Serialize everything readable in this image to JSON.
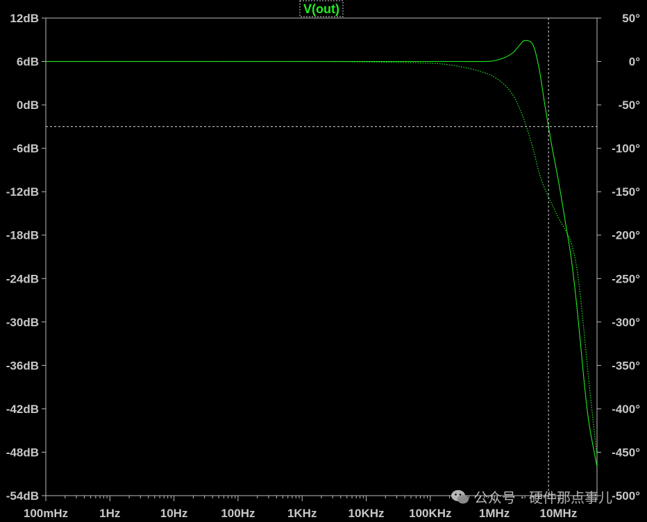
{
  "chart_data": {
    "type": "line",
    "title": "V(out)",
    "x_scale": "log",
    "xlim_hz": [
      0.1,
      40000000
    ],
    "x_tick_values_hz": [
      0.1,
      1,
      10,
      100,
      1000,
      10000,
      100000,
      1000000,
      10000000
    ],
    "x_tick_labels": [
      "100mHz",
      "1Hz",
      "10Hz",
      "100Hz",
      "1KHz",
      "10KHz",
      "100KHz",
      "1MHz",
      "10MHz"
    ],
    "y_left": {
      "unit": "dB",
      "ylim": [
        -54,
        12
      ],
      "tick_values": [
        12,
        6,
        0,
        -6,
        -12,
        -18,
        -24,
        -30,
        -36,
        -42,
        -48,
        -54
      ],
      "tick_labels": [
        "12dB",
        "6dB",
        "0dB",
        "-6dB",
        "-12dB",
        "-18dB",
        "-24dB",
        "-30dB",
        "-36dB",
        "-42dB",
        "-48dB",
        "-54dB"
      ]
    },
    "y_right": {
      "unit": "deg",
      "ylim": [
        -500,
        50
      ],
      "tick_values": [
        50,
        0,
        -50,
        -100,
        -150,
        -200,
        -250,
        -300,
        -350,
        -400,
        -450,
        -500
      ],
      "tick_labels": [
        "50°",
        "0°",
        "-50°",
        "-100°",
        "-150°",
        "-200°",
        "-250°",
        "-300°",
        "-350°",
        "-400°",
        "-450°",
        "-500°"
      ]
    },
    "grid": false,
    "series": [
      {
        "axis": "left",
        "style": "solid",
        "color": "#22ee22",
        "x": [
          0.1,
          1,
          10,
          100,
          1000,
          10000,
          100000,
          300000,
          700000,
          1000000,
          1500000,
          2000000,
          2500000,
          3000000,
          4000000,
          5000000,
          6000000,
          7000000,
          8000000,
          10000000,
          13000000,
          16000000,
          20000000,
          25000000,
          30000000,
          40000000
        ],
        "values": [
          6,
          6,
          6,
          6,
          6,
          6,
          6,
          6,
          6,
          6.1,
          6.6,
          7.3,
          8.3,
          8.9,
          8.3,
          5.0,
          0.5,
          -3.0,
          -6.0,
          -10.5,
          -16.5,
          -21.5,
          -29.0,
          -38.0,
          -44.0,
          -50.0
        ]
      },
      {
        "axis": "right",
        "style": "dotted",
        "color": "#22ee22",
        "x": [
          0.1,
          1,
          10,
          100,
          1000,
          10000,
          100000,
          200000,
          400000,
          700000,
          1000000,
          1500000,
          2000000,
          2500000,
          3000000,
          4000000,
          5000000,
          6000000,
          8000000,
          10000000,
          13000000,
          16000000,
          20000000,
          25000000,
          30000000,
          40000000
        ],
        "values": [
          0,
          0,
          0,
          0,
          0,
          -0.5,
          -2,
          -4,
          -8,
          -13,
          -18,
          -28,
          -40,
          -55,
          -70,
          -100,
          -128,
          -145,
          -165,
          -180,
          -195,
          -210,
          -245,
          -310,
          -370,
          -455
        ]
      }
    ],
    "cursor": {
      "x_hz": 7000000,
      "y_db": -3
    }
  },
  "watermark": {
    "text": "公众号 · 硬件那点事儿",
    "icon": "wechat-icon"
  }
}
